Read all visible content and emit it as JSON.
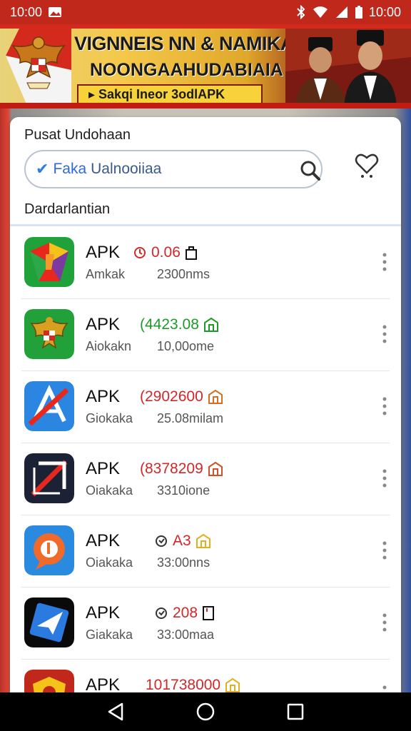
{
  "status_bar": {
    "time_left": "10:00",
    "time_right": "10:00"
  },
  "banner": {
    "line1": "VIGNNEIS NN & NAMIKAN",
    "line2": "NOONGAAHUDABIAIA",
    "tag": "▸ Sakqi Ineor 3odlAPK"
  },
  "card": {
    "title": "Pusat Undohaan",
    "search": {
      "placeholder_prefix": "Faka",
      "placeholder": "Ualnooiiaa"
    },
    "section_label": "Dardarlantian"
  },
  "apps": [
    {
      "name": "APK",
      "badge": "0.06",
      "badge_color": "#d02828",
      "badge_icon": "◔",
      "sub": "Amkak",
      "size": "2300nms",
      "icon": "green-gem-icon"
    },
    {
      "name": "APK",
      "badge": "(4423.08",
      "badge_color": "#1f9a2a",
      "badge_icon": "",
      "sub": "Aiokakn",
      "size": "10,00ome",
      "icon": "garuda-icon"
    },
    {
      "name": "APK",
      "badge": "(2902600",
      "badge_color": "#d02828",
      "badge_icon": "",
      "sub": "Giokaka",
      "size": "25.08milam",
      "icon": "store-a-icon"
    },
    {
      "name": "APK",
      "badge": "(8378209",
      "badge_color": "#d02828",
      "badge_icon": "",
      "sub": "Oiakaka",
      "size": "3310ione",
      "icon": "dark-arrow-icon"
    },
    {
      "name": "APK",
      "badge": "A3",
      "badge_color": "#d02828",
      "badge_icon": "◔",
      "sub": "Oiakaka",
      "size": "33:00nns",
      "icon": "chat-bubble-icon"
    },
    {
      "name": "APK",
      "badge": "208",
      "badge_color": "#d02828",
      "badge_icon": "◔",
      "sub": "Giakaka",
      "size": "33:00maa",
      "icon": "paper-plane-icon"
    },
    {
      "name": "APK",
      "badge": "101738000",
      "badge_color": "#d02828",
      "badge_icon": "",
      "sub": "",
      "size": "",
      "icon": "shield-emblem-icon"
    }
  ]
}
